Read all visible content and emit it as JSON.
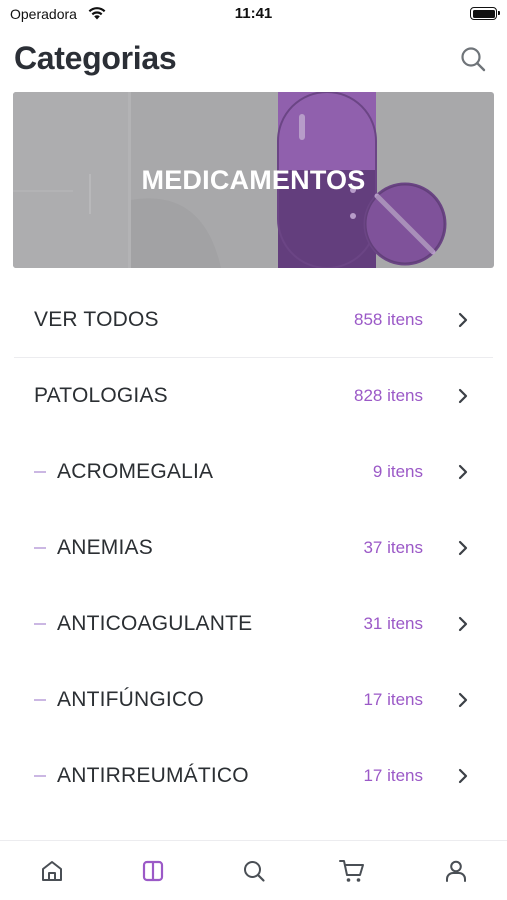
{
  "status_bar": {
    "carrier": "Operadora",
    "time": "11:41"
  },
  "header": {
    "title": "Categorias",
    "search_icon": "search-icon"
  },
  "banner": {
    "title": "MEDICAMENTOS",
    "image": "capsule-pills-illustration"
  },
  "colors": {
    "accent": "#9b59c7",
    "text": "#2b2f33",
    "divider": "#ececef",
    "banner_bg": "#a8a8aa"
  },
  "categories": [
    {
      "label": "VER TODOS",
      "count": "858 itens",
      "sub": false
    },
    {
      "label": "PATOLOGIAS",
      "count": "828 itens",
      "sub": false
    },
    {
      "label": "ACROMEGALIA",
      "count": "9 itens",
      "sub": true
    },
    {
      "label": "ANEMIAS",
      "count": "37 itens",
      "sub": true
    },
    {
      "label": "ANTICOAGULANTE",
      "count": "31 itens",
      "sub": true
    },
    {
      "label": "ANTIFÚNGICO",
      "count": "17 itens",
      "sub": true
    },
    {
      "label": "ANTIRREUMÁTICO",
      "count": "17 itens",
      "sub": true
    }
  ],
  "tab_bar": {
    "active": "categories",
    "tabs": [
      {
        "id": "home",
        "icon": "home-icon"
      },
      {
        "id": "categories",
        "icon": "columns-icon"
      },
      {
        "id": "search",
        "icon": "search-icon"
      },
      {
        "id": "cart",
        "icon": "cart-icon"
      },
      {
        "id": "profile",
        "icon": "user-icon"
      }
    ]
  }
}
